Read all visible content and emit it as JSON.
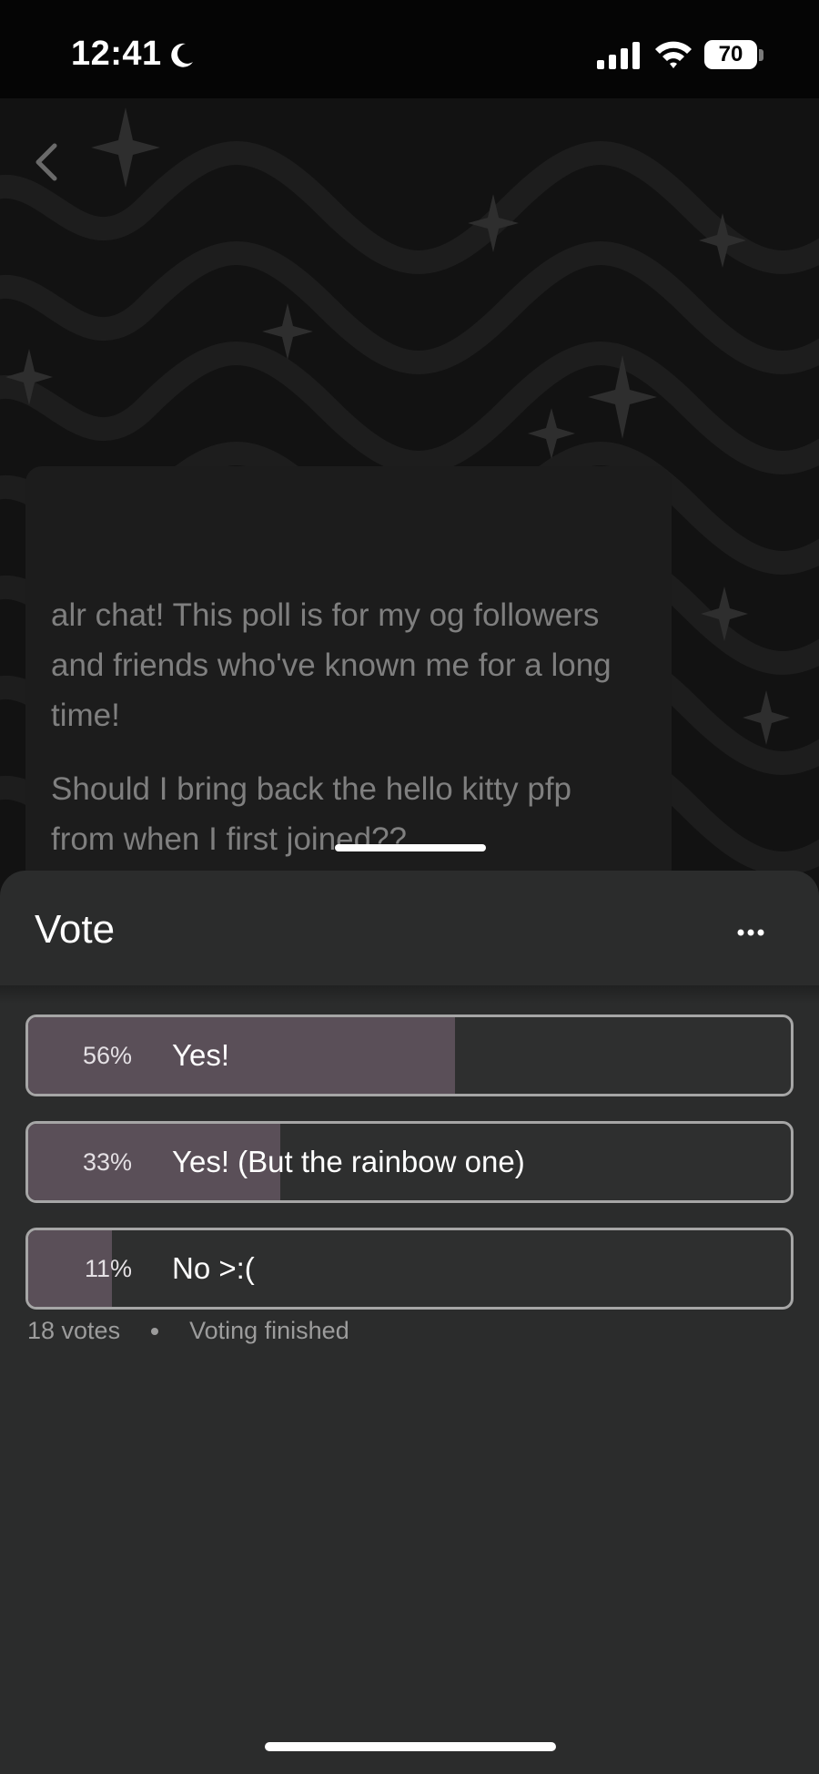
{
  "status_bar": {
    "time": "12:41",
    "battery": "70"
  },
  "post": {
    "paragraphs": [
      "alr chat! This poll is for my og followers and friends who've known me for a long time!",
      "Should I bring back the hello kitty pfp from when I first joined??"
    ]
  },
  "sheet": {
    "title": "Vote",
    "options": [
      {
        "percent": "56%",
        "label": "Yes!",
        "share": 56
      },
      {
        "percent": "33%",
        "label": "Yes! (But the rainbow one)",
        "share": 33
      },
      {
        "percent": "11%",
        "label": "No >:(",
        "share": 11
      }
    ],
    "votes": "18 votes",
    "state": "Voting finished"
  },
  "colors": {
    "sheet_bg": "#2b2c2c",
    "bar_fill": "#5a4f58",
    "border": "#a6a6a6"
  }
}
